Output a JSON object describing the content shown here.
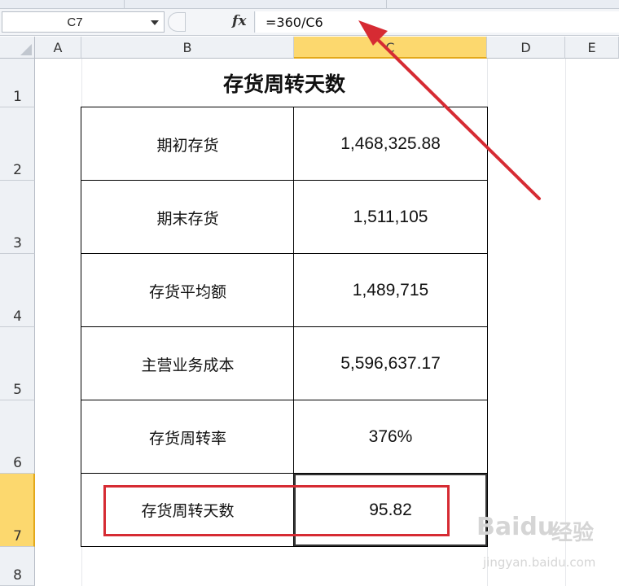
{
  "formula_bar": {
    "name_box_value": "C7",
    "fx_label": "fx",
    "formula_text": "=360/C6"
  },
  "columns": [
    {
      "label": "A"
    },
    {
      "label": "B"
    },
    {
      "label": "C"
    },
    {
      "label": "D"
    },
    {
      "label": "E"
    }
  ],
  "rows": [
    "1",
    "2",
    "3",
    "4",
    "5",
    "6",
    "7",
    "8"
  ],
  "active_cell": {
    "column": "C",
    "row": "7"
  },
  "sheet": {
    "title": "存货周转天数",
    "table": [
      {
        "label": "期初存货",
        "value": "1,468,325.88"
      },
      {
        "label": "期末存货",
        "value": "1,511,105"
      },
      {
        "label": "存货平均额",
        "value": "1,489,715"
      },
      {
        "label": "主营业务成本",
        "value": "5,596,637.17"
      },
      {
        "label": "存货周转率",
        "value": "376%"
      },
      {
        "label": "存货周转天数",
        "value": "95.82"
      }
    ]
  },
  "annotation_color": "#d62b33",
  "watermark": {
    "brand": "Baidu",
    "sub": "经验",
    "url": "jingyan.baidu.com"
  }
}
